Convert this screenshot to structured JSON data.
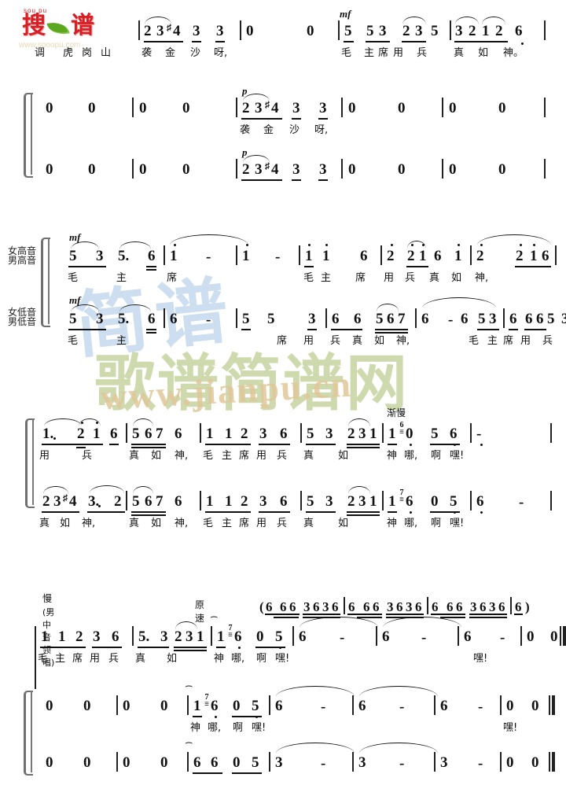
{
  "logo": {
    "pinyin": "sou pu",
    "char1": "搜",
    "char2": "谱",
    "url": "www.sooopu.com",
    "leaf_color": "#5aa820",
    "text_color": "#d61f26"
  },
  "watermark": {
    "blue_text": "简谱",
    "green_text": "歌谱简谱网",
    "url_text": "www.jianpu.cn",
    "blue_color": "#bcd4ea",
    "green_color": "#c3d29a",
    "url_color": "#e0c79a"
  },
  "voice_labels": {
    "soprano_tenor_top": "女高音",
    "soprano_tenor_bottom": "男",
    "alto_bass_top": "女低音",
    "alto_bass_bottom": "男"
  },
  "dynamics": {
    "mf": "mf",
    "p": "p"
  },
  "tempo_marks": {
    "jianman": "渐慢",
    "man": "慢",
    "lead": "(男中音领唱)",
    "yuansu": "原速"
  },
  "systems": [
    {
      "id": "system-1",
      "staves": [
        {
          "id": "staff-1-1",
          "notes": [
            "2",
            "3",
            "4",
            "3",
            "3",
            "0",
            "0",
            "5",
            "5",
            "3",
            "2",
            "3",
            "5",
            "3",
            "2",
            "1",
            "2",
            "6"
          ],
          "lyrics": [
            "调",
            "虎",
            "岗",
            "山",
            "袭",
            "金",
            "沙",
            "呀,",
            "毛",
            "主",
            "席",
            "用",
            "兵",
            "真",
            "如",
            "神。"
          ],
          "dynamics": [
            "mf"
          ]
        },
        {
          "id": "staff-1-2",
          "notes": [
            "0",
            "0",
            "0",
            "0",
            "2",
            "3",
            "4",
            "3",
            "3",
            "0",
            "0",
            "0",
            "0"
          ],
          "lyrics": [
            "袭",
            "金",
            "沙",
            "呀,"
          ],
          "dynamics": [
            "p"
          ]
        },
        {
          "id": "staff-1-3",
          "notes": [
            "0",
            "0",
            "0",
            "0",
            "2",
            "3",
            "4",
            "3",
            "3",
            "0",
            "0",
            "0",
            "0"
          ],
          "lyrics": [],
          "dynamics": [
            "p"
          ]
        }
      ]
    },
    {
      "id": "system-2",
      "staves": [
        {
          "id": "staff-2-1",
          "label": "女高音 / 男",
          "notes": [
            "5",
            "3",
            "5.",
            "6",
            "1",
            "-",
            "1",
            "-",
            "1",
            "1",
            "6",
            "2",
            "2",
            "1",
            "6",
            "1",
            "2",
            "2",
            "1",
            "6"
          ],
          "lyrics": [
            "毛",
            "主",
            "席",
            "毛",
            "主",
            "席",
            "用",
            "兵",
            "真",
            "如",
            "神,"
          ],
          "dynamics": [
            "mf"
          ]
        },
        {
          "id": "staff-2-2",
          "label": "女低音 / 男",
          "notes": [
            "5",
            "3",
            "5.",
            "6",
            "6",
            "-",
            "5",
            "5",
            "3",
            "6",
            "6",
            "5",
            "6",
            "7",
            "6",
            "-",
            "6",
            "5",
            "3",
            "6",
            "6",
            "6",
            "5",
            "3"
          ],
          "lyrics": [
            "毛",
            "主",
            "席",
            "用",
            "兵",
            "真",
            "如",
            "神,",
            "毛",
            "主",
            "席",
            "用",
            "兵"
          ],
          "dynamics": [
            "mf"
          ]
        }
      ]
    },
    {
      "id": "system-3",
      "staves": [
        {
          "id": "staff-3-1",
          "notes": [
            "1.",
            "2",
            "1",
            "6",
            "5",
            "6",
            "7",
            "6",
            "1",
            "1",
            "2",
            "3",
            "6",
            "5",
            "3",
            "2",
            "3",
            "1",
            "1",
            "7",
            "6",
            "0",
            "5",
            "6",
            "-"
          ],
          "lyrics": [
            "用",
            "兵",
            "真",
            "如",
            "神,",
            "毛",
            "主",
            "席",
            "用",
            "兵",
            "真",
            "如",
            "神",
            "哪,",
            "啊",
            "嘿!"
          ],
          "tempo": "渐慢"
        },
        {
          "id": "staff-3-2",
          "notes": [
            "2",
            "3",
            "4",
            "3.",
            "2",
            "5",
            "6",
            "7",
            "6",
            "1",
            "1",
            "2",
            "3",
            "6",
            "5",
            "3",
            "2",
            "3",
            "1",
            "1",
            "7",
            "6",
            "0",
            "5",
            "6",
            "-"
          ],
          "lyrics": [
            "真",
            "如",
            "神,",
            "真",
            "如",
            "神,",
            "毛",
            "主",
            "席",
            "用",
            "兵",
            "真",
            "如",
            "神",
            "哪,",
            "啊",
            "嘿!"
          ]
        }
      ]
    },
    {
      "id": "system-4",
      "staves": [
        {
          "id": "staff-4-1",
          "notes": [
            "1",
            "1",
            "2",
            "3",
            "6",
            "5.",
            "3",
            "2",
            "3",
            "1",
            "1",
            "7",
            "6",
            "0",
            "5",
            "6",
            "-",
            "6",
            "-",
            "6",
            "-",
            "0",
            "0"
          ],
          "cue_notes": [
            "6",
            "6",
            "6",
            "3",
            "6",
            "3",
            "6",
            "6",
            "6",
            "6",
            "3",
            "6",
            "3",
            "6",
            "6",
            "6",
            "6",
            "3",
            "6",
            "3",
            "6",
            "6"
          ],
          "lyrics": [
            "毛",
            "主",
            "席",
            "用",
            "兵",
            "真",
            "如",
            "神",
            "哪,",
            "啊",
            "嘿!",
            "嘿!"
          ],
          "tempo_left": "慢",
          "tempo_left_sub": "(男中音领唱)",
          "tempo_mid": "原速"
        },
        {
          "id": "staff-4-2",
          "notes": [
            "0",
            "0",
            "0",
            "0",
            "1",
            "7",
            "6",
            "0",
            "5",
            "6",
            "-",
            "6",
            "-",
            "6",
            "-",
            "0",
            "0"
          ],
          "lyrics": [
            "神",
            "哪,",
            "啊",
            "嘿!",
            "嘿!"
          ]
        },
        {
          "id": "staff-4-3",
          "notes": [
            "0",
            "0",
            "0",
            "0",
            "6",
            "6",
            "0",
            "5",
            "3",
            "-",
            "3",
            "-",
            "3",
            "-",
            "0",
            "0"
          ],
          "lyrics": []
        }
      ]
    }
  ]
}
